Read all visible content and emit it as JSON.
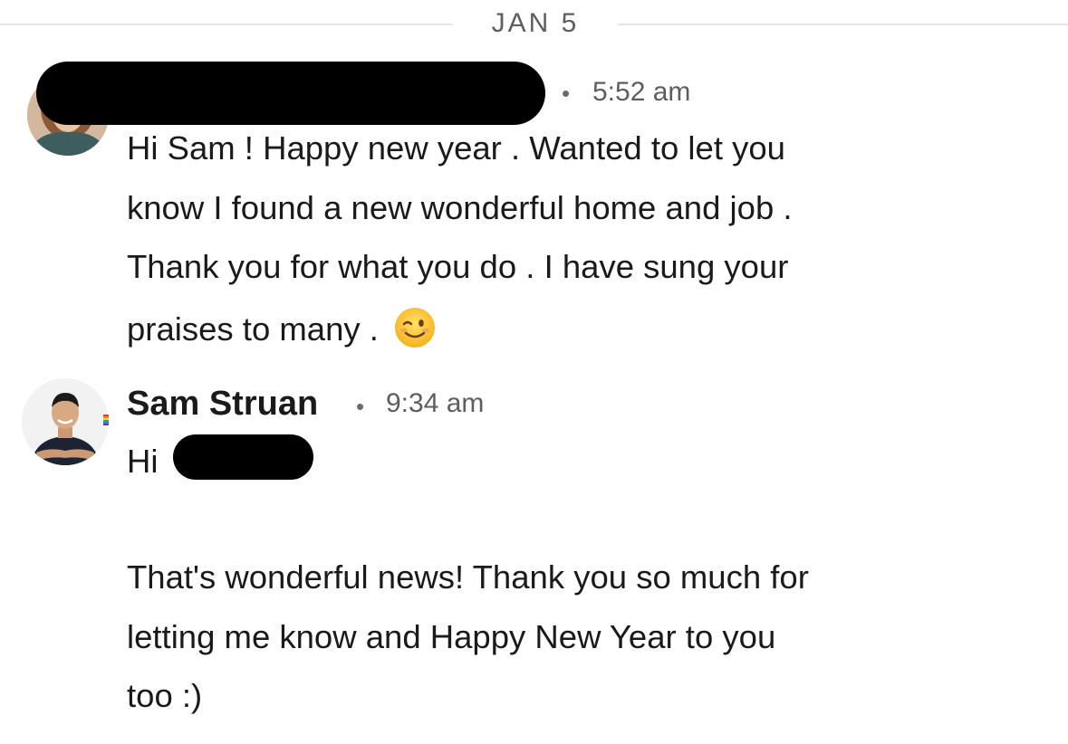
{
  "date_separator": "JAN 5",
  "messages": [
    {
      "sender": "",
      "time": "5:52 am",
      "lines": [
        "Hi Sam ! Happy new year . Wanted to let you",
        "know I found a new wonderful home and job .",
        "Thank you for what you do . I have sung your",
        "praises to many ."
      ],
      "emoji": "winking-face-emoji"
    },
    {
      "sender": "Sam Struan",
      "time": "9:34 am",
      "greeting": "Hi",
      "lines": [
        "That's wonderful news! Thank you so much for",
        "letting me know and Happy New Year to you",
        "too :)"
      ]
    }
  ],
  "icons": {
    "avatar_1": "avatar",
    "avatar_2": "avatar",
    "emoji": "winking-face-emoji"
  },
  "colors": {
    "text": "#1a1a1a",
    "muted": "#5e5e5e",
    "redaction": "#000000",
    "separator": "#e6e6e6"
  }
}
